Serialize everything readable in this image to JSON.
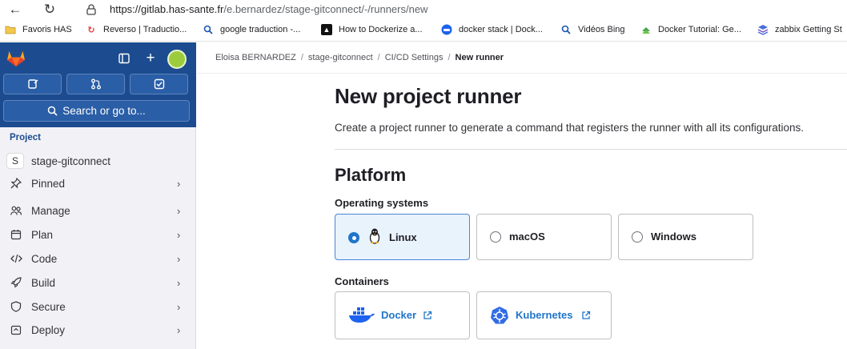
{
  "browser": {
    "url_host": "https://gitlab.has-sante.fr",
    "url_path": "/e.bernardez/stage-gitconnect/-/runners/new",
    "bookmarks": [
      {
        "label": "Favoris HAS",
        "icon": "folder-icon"
      },
      {
        "label": "Reverso | Traductio...",
        "icon": "reverso-icon"
      },
      {
        "label": "google traduction -...",
        "icon": "search-icon"
      },
      {
        "label": "How to Dockerize a...",
        "icon": "dockerize-icon"
      },
      {
        "label": "docker stack | Dock...",
        "icon": "docker-icon"
      },
      {
        "label": "Vidéos Bing",
        "icon": "search-icon"
      },
      {
        "label": "Docker Tutorial: Ge...",
        "icon": "tutorial-icon"
      },
      {
        "label": "zabbix Getting St",
        "icon": "zabbix-icon"
      }
    ]
  },
  "sidebar": {
    "search_label": "Search or go to...",
    "section_label": "Project",
    "project_initial": "S",
    "project_name": "stage-gitconnect",
    "items": [
      {
        "label": "Pinned"
      },
      {
        "label": "Manage"
      },
      {
        "label": "Plan"
      },
      {
        "label": "Code"
      },
      {
        "label": "Build"
      },
      {
        "label": "Secure"
      },
      {
        "label": "Deploy"
      }
    ]
  },
  "breadcrumb": [
    "Eloisa BERNARDEZ",
    "stage-gitconnect",
    "CI/CD Settings",
    "New runner"
  ],
  "main": {
    "title": "New project runner",
    "description": "Create a project runner to generate a command that registers the runner with all its configurations.",
    "platform_heading": "Platform",
    "os_label": "Operating systems",
    "os_options": [
      {
        "label": "Linux",
        "selected": true
      },
      {
        "label": "macOS",
        "selected": false
      },
      {
        "label": "Windows",
        "selected": false
      }
    ],
    "containers_label": "Containers",
    "containers": [
      {
        "label": "Docker",
        "icon": "docker-icon"
      },
      {
        "label": "Kubernetes",
        "icon": "kubernetes-icon"
      }
    ]
  },
  "colors": {
    "sidebar_top": "#1c4c8f",
    "link": "#1f75cb",
    "selected_card_bg": "#e9f3fc"
  }
}
